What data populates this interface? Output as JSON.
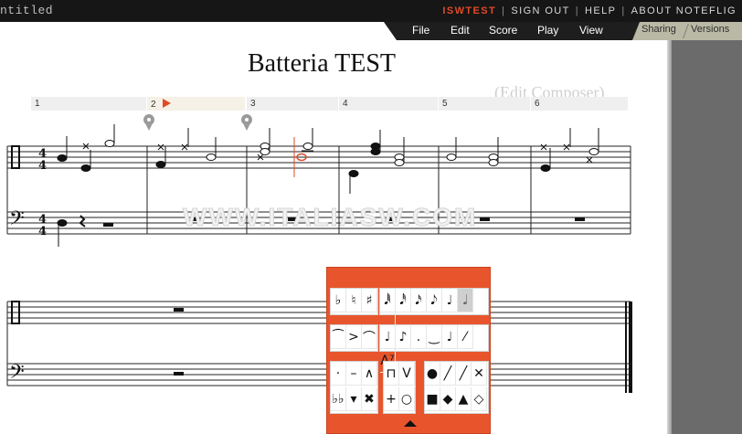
{
  "topbar": {
    "doc_title": "ntitled",
    "username": "ISWTEST",
    "sign_out": "SIGN OUT",
    "help": "HELP",
    "about": "ABOUT NOTEFLIG",
    "separator": "|"
  },
  "menu": {
    "file": "File",
    "edit": "Edit",
    "score": "Score",
    "play": "Play",
    "view": "View",
    "sharing": "Sharing",
    "versions": "Versions"
  },
  "score": {
    "title": "Batteria TEST",
    "composer": "(Edit Composer)",
    "measures": [
      "1",
      "2",
      "3",
      "4",
      "5",
      "6"
    ],
    "time_signature": {
      "top": "4",
      "bottom": "4"
    },
    "watermark": "WWW.ITALIASW.COM"
  },
  "palette": {
    "accidentals": [
      "♭",
      "♮",
      "♯"
    ],
    "durations": [
      "𝅘𝅥𝅱",
      "𝅘𝅥𝅰",
      "𝅘𝅥𝅯",
      "𝅘𝅥𝅮",
      "♩",
      "𝅗𝅥",
      "𝅝"
    ],
    "articulations": [
      "⁀",
      ">",
      "⌒"
    ],
    "beams": [
      "♩",
      "♪",
      ".",
      "‿",
      "♩",
      "⁄",
      "A⁷"
    ],
    "marks": [
      "·",
      "–",
      "∧",
      "♭♭",
      "▾",
      "✖"
    ],
    "bowing": [
      "⊓",
      "V",
      "+",
      "○"
    ],
    "noteheads": [
      "●",
      "╱",
      "╱",
      "✕",
      "■",
      "◆",
      "▲",
      "◇"
    ]
  },
  "colors": {
    "accent": "#e04a26",
    "palette_bg": "#e8552c",
    "topbar_bg": "#161616",
    "panel_bg": "#6b6b6b"
  }
}
